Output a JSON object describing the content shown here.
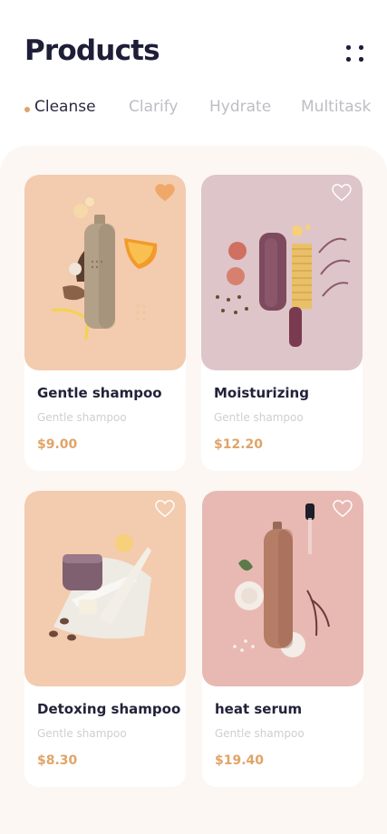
{
  "header": {
    "title": "Products",
    "menu_icon": "grid-dots-icon"
  },
  "tabs": [
    {
      "label": "Cleanse",
      "active": true
    },
    {
      "label": "Clarify",
      "active": false
    },
    {
      "label": "Hydrate",
      "active": false
    },
    {
      "label": "Multitask",
      "active": false
    }
  ],
  "products": [
    {
      "name": "Gentle shampoo",
      "subtitle": "Gentle shampoo",
      "price": "$9.00",
      "favorite": true,
      "bg": "#f3cbae"
    },
    {
      "name": "Moisturizing",
      "subtitle": "Gentle shampoo",
      "price": "$12.20",
      "favorite": false,
      "bg": "#dec5c9"
    },
    {
      "name": "Detoxing shampoo",
      "subtitle": "Gentle shampoo",
      "price": "$8.30",
      "favorite": false,
      "bg": "#f3cbae"
    },
    {
      "name": "heat serum",
      "subtitle": "Gentle shampoo",
      "price": "$19.40",
      "favorite": false,
      "bg": "#e8b9b3"
    }
  ],
  "bottle_label": "FORM",
  "colors": {
    "accent": "#e0a468",
    "heart_filled": "#f0a868",
    "title": "#1e1e38",
    "tab_inactive": "#bdbdc4"
  }
}
